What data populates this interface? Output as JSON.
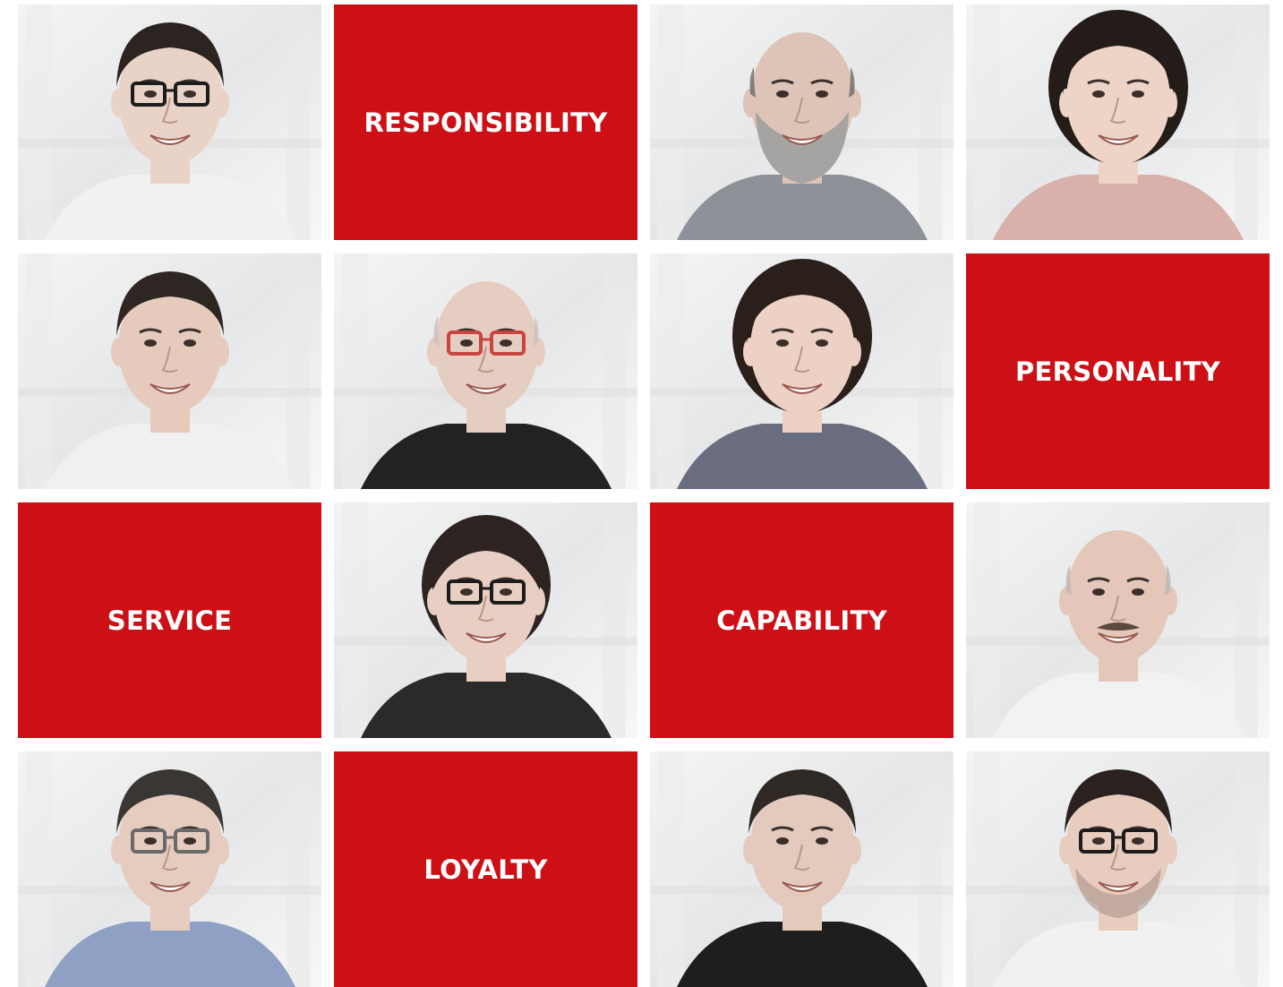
{
  "colors": {
    "accent_red": "#cc1016",
    "background": "#ffffff",
    "label_text": "#ffffff"
  },
  "tiles": [
    {
      "kind": "photo",
      "name": "portrait-man-glasses-1",
      "person": {
        "skin": "#e9d3c6",
        "hair": "#2b2420",
        "hairStyle": "short",
        "top": "#f1f1f1",
        "glasses": "#1c1c1c",
        "beard": ""
      }
    },
    {
      "kind": "word",
      "label": "RESPONSIBILITY"
    },
    {
      "kind": "photo",
      "name": "portrait-man-beard",
      "person": {
        "skin": "#ddc4b6",
        "hair": "#6d6a68",
        "hairStyle": "bald",
        "top": "#8e9298",
        "glasses": "",
        "beard": "#a6a4a2"
      }
    },
    {
      "kind": "photo",
      "name": "portrait-woman-curly",
      "person": {
        "skin": "#eed3c7",
        "hair": "#231c19",
        "hairStyle": "curly",
        "top": "#dab0aa",
        "glasses": "",
        "beard": ""
      }
    },
    {
      "kind": "photo",
      "name": "portrait-man-smiling",
      "person": {
        "skin": "#e6cbbd",
        "hair": "#2e2622",
        "hairStyle": "short",
        "top": "#f0f0f0",
        "glasses": "",
        "beard": ""
      }
    },
    {
      "kind": "photo",
      "name": "portrait-man-red-glasses",
      "person": {
        "skin": "#e6cdc2",
        "hair": "#c9c2be",
        "hairStyle": "bald",
        "top": "#222222",
        "glasses": "#c8463f",
        "beard": ""
      }
    },
    {
      "kind": "photo",
      "name": "portrait-woman-wavy",
      "person": {
        "skin": "#ecd1c4",
        "hair": "#2a1f1b",
        "hairStyle": "curly",
        "top": "#6a6c80",
        "glasses": "",
        "beard": ""
      }
    },
    {
      "kind": "word",
      "label": "PERSONALITY"
    },
    {
      "kind": "word",
      "label": "SERVICE"
    },
    {
      "kind": "photo",
      "name": "portrait-woman-glasses",
      "person": {
        "skin": "#e9cfc3",
        "hair": "#2d2421",
        "hairStyle": "bob",
        "top": "#2a2a2a",
        "glasses": "#1c1c1c",
        "beard": ""
      }
    },
    {
      "kind": "word",
      "label": "CAPABILITY"
    },
    {
      "kind": "photo",
      "name": "portrait-man-mustache",
      "person": {
        "skin": "#e4c7b8",
        "hair": "#bdb6b2",
        "hairStyle": "bald",
        "top": "#f2f2f2",
        "glasses": "",
        "beard": "mustache"
      }
    },
    {
      "kind": "photo",
      "name": "portrait-man-glasses-2",
      "person": {
        "skin": "#e5ccbf",
        "hair": "#3a3633",
        "hairStyle": "short",
        "top": "#8ea0c4",
        "glasses": "#6a6a6a",
        "beard": ""
      }
    },
    {
      "kind": "word",
      "label": "LOYALTY"
    },
    {
      "kind": "photo",
      "name": "portrait-man-dark-suit",
      "person": {
        "skin": "#e4cabd",
        "hair": "#2f2926",
        "hairStyle": "short",
        "top": "#1e1e1e",
        "glasses": "",
        "beard": ""
      }
    },
    {
      "kind": "photo",
      "name": "portrait-man-glasses-3",
      "person": {
        "skin": "#e8cdbf",
        "hair": "#2b221f",
        "hairStyle": "short",
        "top": "#f1f1f1",
        "glasses": "#1c1c1c",
        "beard": "stubble"
      }
    }
  ]
}
